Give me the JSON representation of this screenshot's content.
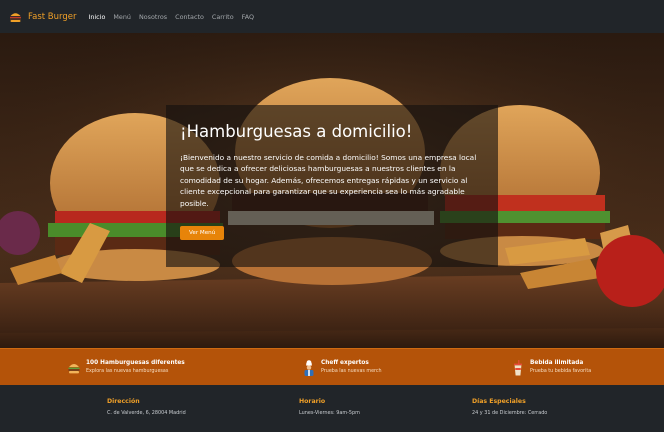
{
  "navbar": {
    "brand": "Fast Burger",
    "links": [
      {
        "label": "Inicio",
        "active": true
      },
      {
        "label": "Menú"
      },
      {
        "label": "Nosotros"
      },
      {
        "label": "Contacto"
      },
      {
        "label": "Carrito"
      },
      {
        "label": "FAQ"
      }
    ]
  },
  "hero": {
    "title": "¡Hamburguesas a domicilio!",
    "text": "¡Bienvenido a nuestro servicio de comida a domicilio! Somos una empresa local que se dedica a ofrecer deliciosas hamburguesas a nuestros clientes en la comodidad de su hogar. Además, ofrecemos entregas rápidas y un servicio al cliente excepcional para garantizar que su experiencia sea lo más agradable posible.",
    "button": "Ver Menú"
  },
  "features": [
    {
      "icon": "burger-icon",
      "title": "100 Hamburguesas diferentes",
      "desc": "Explora las nuevas hamburguesas"
    },
    {
      "icon": "chef-icon",
      "title": "Cheff expertos",
      "desc": "Prueba las nuevas merch"
    },
    {
      "icon": "drink-icon",
      "title": "Bebida ilimitada",
      "desc": "Prueba tu bebida favorita"
    }
  ],
  "footer": {
    "columns": [
      {
        "title": "Dirección",
        "text": "C. de Valverde, 6, 28004 Madrid"
      },
      {
        "title": "Horario",
        "text": "Lunes-Viernes: 9am-5pm"
      },
      {
        "title": "Días Especiales",
        "text": "24 y 31 de Diciembre: Cerrado"
      }
    ]
  },
  "colors": {
    "accent": "#f0a028",
    "button": "#e78409",
    "strip": "#b45309",
    "dark": "#212529"
  }
}
